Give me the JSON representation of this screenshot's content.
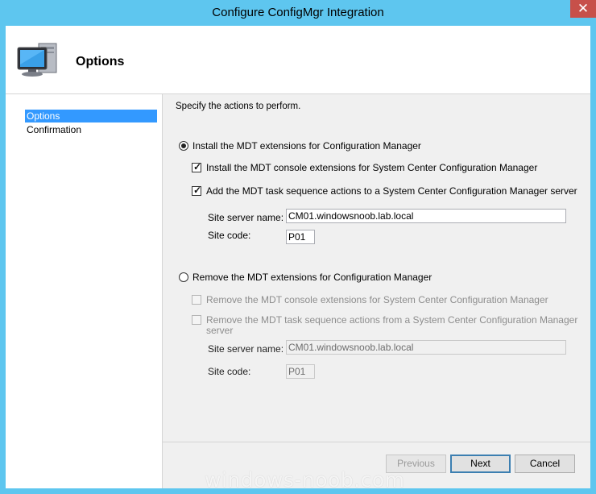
{
  "window": {
    "title": "Configure ConfigMgr Integration",
    "close_glyph": "✕"
  },
  "header": {
    "title": "Options",
    "icon": "computer-icon"
  },
  "nav": {
    "items": [
      {
        "label": "Options",
        "selected": true
      },
      {
        "label": "Confirmation",
        "selected": false
      }
    ]
  },
  "main": {
    "instruction": "Specify the actions to perform.",
    "install_option": {
      "label": "Install the MDT extensions for Configuration Manager",
      "selected": true,
      "console_ext_label": "Install the MDT console extensions for System Center Configuration Manager",
      "console_ext_checked": true,
      "ts_actions_label": "Add the MDT task sequence actions to a System Center Configuration Manager server",
      "ts_actions_checked": true,
      "site_server_label": "Site server name:",
      "site_server_value": "CM01.windowsnoob.lab.local",
      "site_code_label": "Site code:",
      "site_code_value": "P01"
    },
    "remove_option": {
      "label": "Remove the MDT extensions for Configuration Manager",
      "selected": false,
      "console_ext_label": "Remove the MDT console extensions for System Center Configuration Manager",
      "console_ext_checked": false,
      "ts_actions_label_line1": "Remove the MDT task sequence actions from a System Center Configuration Manager",
      "ts_actions_label_line2": "server",
      "ts_actions_checked": false,
      "site_server_label": "Site server name:",
      "site_server_value": "CM01.windowsnoob.lab.local",
      "site_code_label": "Site code:",
      "site_code_value": "P01"
    }
  },
  "buttons": {
    "previous": "Previous",
    "next": "Next",
    "cancel": "Cancel"
  },
  "watermark": "windows-noob.com",
  "colors": {
    "titlebar": "#5ec6ef",
    "close": "#c7504a",
    "selection": "#3399ff"
  }
}
